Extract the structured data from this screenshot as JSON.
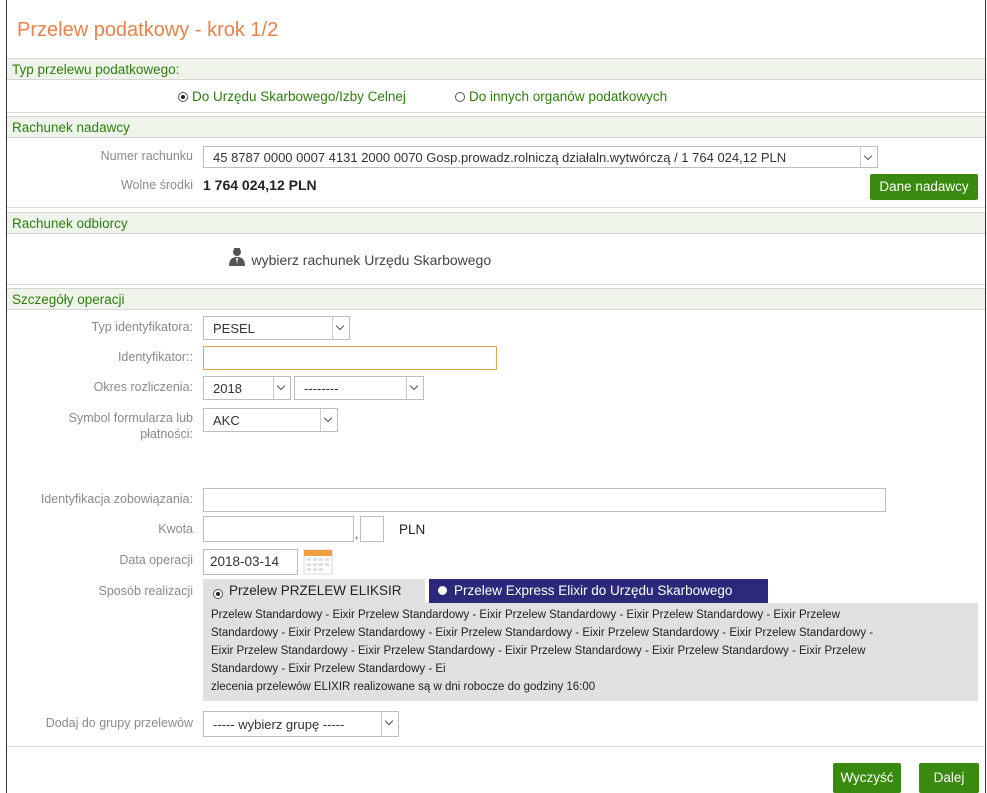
{
  "page": {
    "title": "Przelew podatkowy - krok 1/2"
  },
  "sections": {
    "type": "Typ przelewu podatkowego:",
    "sender": "Rachunek nadawcy",
    "recipient": "Rachunek odbiorcy",
    "details": "Szczegóły operacji"
  },
  "tax_type": {
    "option1": "Do Urzędu Skarbowego/Izby Celnej",
    "option2": "Do innych organów podatkowych",
    "selected": "option1"
  },
  "sender": {
    "account_label": "Numer rachunku",
    "account_value": "45 8787 0000 0007 4131 2000 0070 Gosp.prowadz.rolniczą działaln.wytwórczą / 1 764 024,12 PLN",
    "funds_label": "Wolne środki",
    "funds_value": "1 764 024,12 PLN",
    "details_button": "Dane nadawcy"
  },
  "recipient": {
    "choose_link": "wybierz rachunek Urzędu Skarbowego",
    "icon": "user-icon"
  },
  "details": {
    "id_type_label": "Typ identyfikatora:",
    "id_type_value": "PESEL",
    "identifier_label": "Identyfikator::",
    "identifier_value": "",
    "period_label": "Okres rozliczenia:",
    "period_year": "2018",
    "period_sub": "--------",
    "symbol_label_1": "Symbol formularza lub",
    "symbol_label_2": "płatności:",
    "symbol_value": "AKC",
    "obligation_label": "Identyfikacja zobowiązania:",
    "obligation_value": "",
    "amount_label": "Kwota",
    "amount_sep": ",",
    "currency": "PLN",
    "date_label": "Data operacji",
    "date_value": "2018-03-14",
    "mode_label": "Sposób realizacji",
    "mode_option1": "Przelew PRZELEW ELIKSIR",
    "mode_option2": "Przelew Express Elixir do Urzędu Skarbowego",
    "mode_selected": "option1",
    "info_lines": [
      "Przelew Standardowy - Eixir Przelew Standardowy - Eixir Przelew Standardowy - Eixir Przelew Standardowy - Eixir Przelew",
      "Standardowy - Eixir Przelew Standardowy - Eixir Przelew Standardowy - Eixir Przelew Standardowy - Eixir Przelew Standardowy -",
      "Eixir Przelew Standardowy - Eixir Przelew Standardowy - Eixir Przelew Standardowy - Eixir Przelew Standardowy - Eixir Przelew",
      "Standardowy - Eixir Przelew Standardowy - Ei",
      "zlecenia przelewów ELIXIR realizowane są w dni robocze do godziny 16:00"
    ],
    "group_label": "Dodaj do grupy przelewów",
    "group_value": "----- wybierz grupę -----"
  },
  "actions": {
    "clear": "Wyczyść",
    "next": "Dalej"
  },
  "colors": {
    "accent_orange": "#e8824a",
    "green": "#3a8a0f",
    "navy": "#2b2a7a"
  }
}
